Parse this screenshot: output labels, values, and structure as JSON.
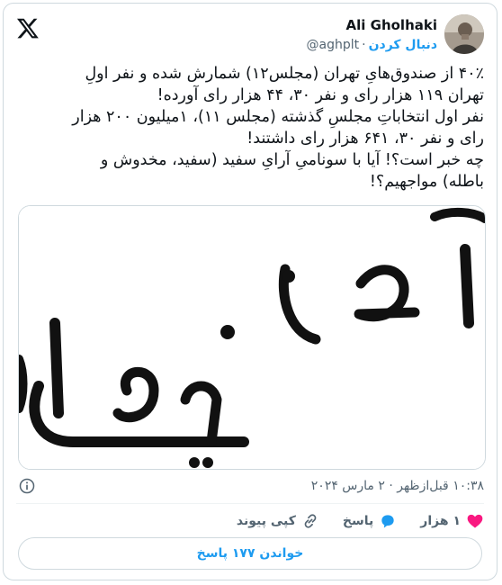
{
  "author": {
    "name": "Ali Gholhaki",
    "handle": "@aghplt",
    "follow_label": "دنبال کردن"
  },
  "tweet_lines": [
    "۴۰٪ از صندوق‌هایِ تهران (مجلس۱۲) شمارش شده و نفر اولِ",
    "تهران ۱۱۹ هزار رای و نفر ۳۰، ۴۴ هزار رای آورده!",
    "نفر اول انتخاباتِ مجلسِ گذشته (مجلس ۱۱)، ۱میلیون ۲۰۰ هزار",
    "رای و نفر ۳۰، ۶۴۱ هزار رای داشتند!",
    "چه خبر است؟! آیا با سونامیِ آرایِ سفید (سفید، مخدوش و",
    "باطله) مواجهیم؟!"
  ],
  "timestamp": "۱۰:۳۸ قبل‌ازظهر · ۲ مارس ۲۰۲۴",
  "actions": {
    "likes": "۱ هزار",
    "reply": "پاسخ",
    "copy_link": "کپی پیوند"
  },
  "read_replies": "خواندن ۱۷۷ پاسخ",
  "colors": {
    "accent": "#1d9bf0",
    "like": "#f91880",
    "text": "#0f1419",
    "muted": "#536471"
  },
  "icons": [
    "x-logo-icon",
    "info-icon",
    "heart-icon",
    "reply-bubble-icon",
    "link-icon"
  ]
}
